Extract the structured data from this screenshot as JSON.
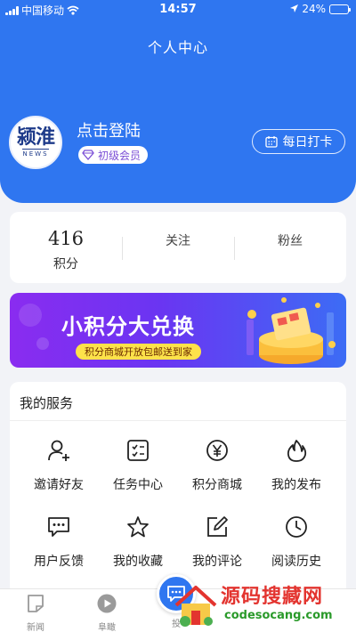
{
  "status_bar": {
    "carrier": "中国移动",
    "time": "14:57",
    "battery": "24%"
  },
  "header": {
    "title": "个人中心",
    "avatar_logo": "颍淮",
    "avatar_logo_sub": "NEWS",
    "login_text": "点击登陆",
    "member_level": "初级会员",
    "checkin_label": "每日打卡"
  },
  "stats": {
    "points_value": "416",
    "points_label": "积分",
    "follow_label": "关注",
    "fans_label": "粉丝"
  },
  "banner": {
    "title": "小积分大兑换",
    "subtitle": "积分商城开放包邮送到家"
  },
  "services": {
    "title": "我的服务",
    "items": [
      {
        "label": "邀请好友",
        "icon": "add-user-icon"
      },
      {
        "label": "任务中心",
        "icon": "task-list-icon"
      },
      {
        "label": "积分商城",
        "icon": "yen-icon"
      },
      {
        "label": "我的发布",
        "icon": "flame-icon"
      },
      {
        "label": "用户反馈",
        "icon": "feedback-icon"
      },
      {
        "label": "我的收藏",
        "icon": "star-icon"
      },
      {
        "label": "我的评论",
        "icon": "edit-icon"
      },
      {
        "label": "阅读历史",
        "icon": "clock-icon"
      }
    ]
  },
  "tabbar": {
    "items": [
      {
        "label": "新闻",
        "icon": "news-icon"
      },
      {
        "label": "阜瞰",
        "icon": "play-icon"
      },
      {
        "label": "投",
        "icon": "chat-icon"
      }
    ]
  },
  "watermark": {
    "text": "源码搜藏网",
    "url": "codesocang.com"
  },
  "colors": {
    "primary": "#2f76f0",
    "background": "#f2f3f7",
    "member": "#7b4fd6",
    "banner_yellow": "#fde24a"
  }
}
